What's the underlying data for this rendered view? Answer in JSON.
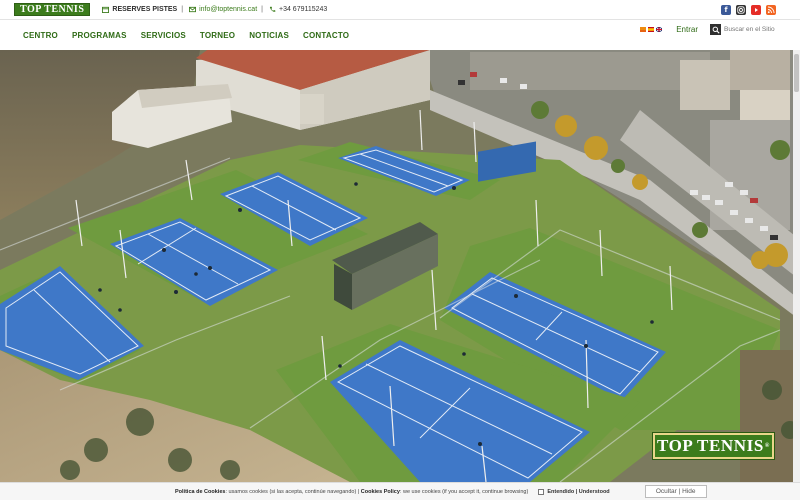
{
  "topbar": {
    "logo_text": "Top Tennis",
    "reserves_label": "RESERVES PISTES",
    "email": "info@toptennis.cat",
    "phone": "+34 679115243",
    "separator": "|",
    "social_icons": [
      "facebook-icon",
      "instagram-icon",
      "youtube-icon",
      "rss-icon"
    ],
    "colors": {
      "facebook": "#3b5998",
      "instagram": "#333333",
      "youtube": "#e52d27",
      "rss": "#f26522"
    }
  },
  "nav": {
    "items": [
      "CENTRO",
      "PROGRAMAS",
      "SERVICIOS",
      "TORNEO",
      "NOTICIAS",
      "CONTACTO"
    ],
    "login_label": "Entrar",
    "search_placeholder": "Buscar en el Sitio",
    "language_flags": [
      "catalan-flag-icon",
      "spanish-flag-icon",
      "english-flag-icon"
    ]
  },
  "hero": {
    "logo_text": "Top Tennis",
    "logo_mark": "®",
    "brand_green": "#3c7c1c",
    "court_blue": "#3f78c8",
    "court_green": "#6f9b3f"
  },
  "cookie": {
    "policy_label": "Política de Cookies",
    "text_ca": ": usamos cookies (si las acepta, continúe navegando) |",
    "policy_label_en": "Cookies Policy",
    "text_en": ": we use cookies (if you accept it, continue browsing)",
    "accept_label": "Entendido | Understood",
    "hide_button": "Ocultar | Hide"
  }
}
